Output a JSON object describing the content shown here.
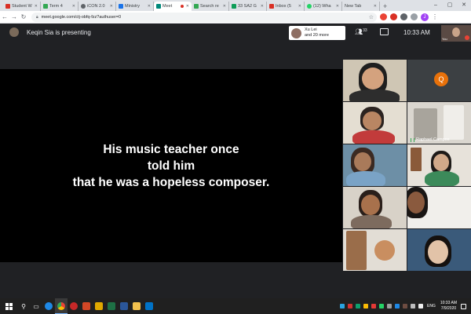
{
  "browser": {
    "tabs": [
      {
        "title": "Student W",
        "fav_color": "#d93025",
        "active": false
      },
      {
        "title": "Term 4",
        "fav_color": "#34a853",
        "active": false
      },
      {
        "title": "iCON 2.0",
        "fav_color": "#5f6368",
        "active": false
      },
      {
        "title": "Ministry",
        "fav_color": "#1a73e8",
        "active": false
      },
      {
        "title": "Meet",
        "fav_color": "#00897b",
        "active": true
      },
      {
        "title": "Search re",
        "fav_color": "#34a853",
        "active": false
      },
      {
        "title": "33 SA2 G",
        "fav_color": "#0f9d58",
        "active": false
      },
      {
        "title": "Inbox (5",
        "fav_color": "#d93025",
        "active": false
      },
      {
        "title": "(12) Wha",
        "fav_color": "#25d366",
        "active": false
      },
      {
        "title": "New Tab",
        "fav_color": "#ffffff",
        "active": false
      }
    ],
    "new_tab_symbol": "+",
    "url": "meet.google.com/ctj-obfq-fzz?authuser=0"
  },
  "meet": {
    "presenter_text": "Keqin Sia is presenting",
    "people_chip": {
      "line1": "Xu Lei",
      "line2": "and 20 more"
    },
    "participant_count": "33",
    "time": "10:33 AM",
    "self_label": "You"
  },
  "presentation": {
    "lines": [
      "His music teacher once",
      "told him",
      "that he was a hopeless composer."
    ]
  },
  "tiles": [
    {
      "label": ""
    },
    {
      "label": ""
    },
    {
      "label": ""
    },
    {
      "label": "Raphael Campos"
    },
    {
      "label": ""
    },
    {
      "label": ""
    },
    {
      "label": ""
    },
    {
      "label": ""
    },
    {
      "label": ""
    },
    {
      "label": ""
    }
  ],
  "tile_avatar_letter": "Q",
  "taskbar": {
    "lang": "ENG",
    "time": "10:33 AM",
    "date": "7/9/2020"
  },
  "colors": {
    "meet_bg": "#202124",
    "stage_bg": "#000000",
    "avatar_orange": "#e8710a"
  }
}
